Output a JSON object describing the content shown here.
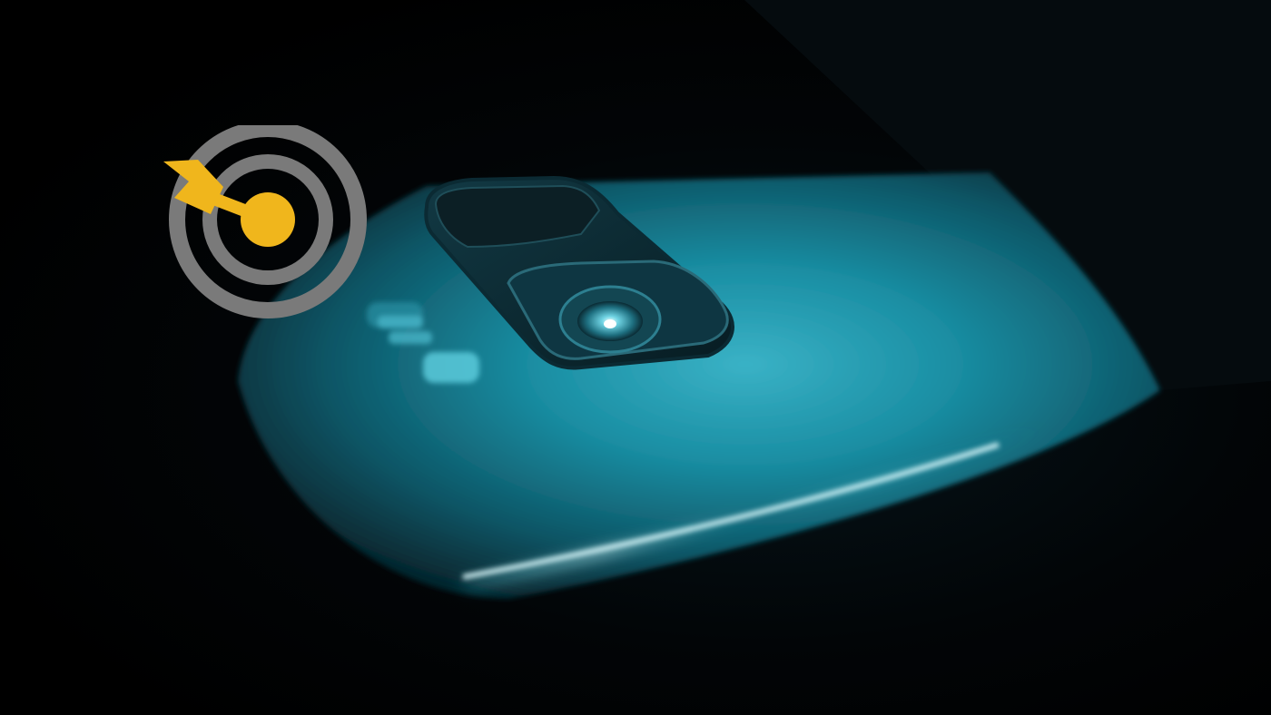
{
  "scene": {
    "subject": "smartphone-back",
    "background_color": "#000000",
    "phone_body_color": "#1a93a8",
    "phone_edge_highlight": "#bff6ff",
    "camera_module_color": "#0a1a20"
  },
  "logo": {
    "icon": "target-arrow-icon",
    "ring_color": "#7a7a7a",
    "ring_inner_color": "#1a1a1a",
    "arrow_color": "#f0b61c"
  }
}
